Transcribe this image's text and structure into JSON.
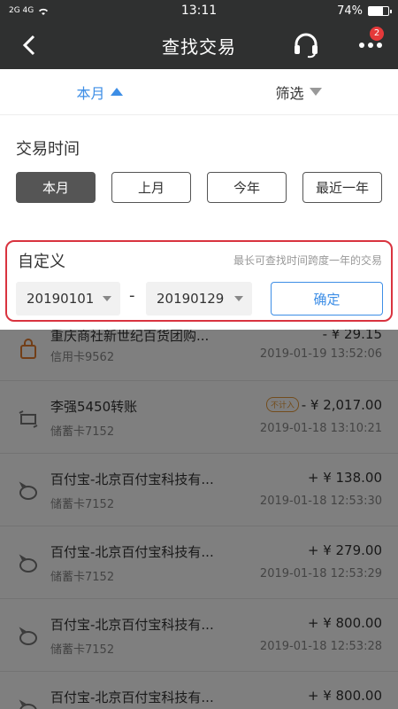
{
  "status_bar": {
    "signal": "2G 4G",
    "time": "13:11",
    "battery": "74%",
    "battery_level": 0.74
  },
  "header": {
    "title": "查找交易",
    "badge_count": "2"
  },
  "tabs": [
    {
      "label": "本月"
    },
    {
      "label": "筛选"
    }
  ],
  "filter": {
    "section_title": "交易时间",
    "periods": [
      "本月",
      "上月",
      "今年",
      "最近一年"
    ],
    "selected_period": "本月",
    "custom": {
      "title": "自定义",
      "hint": "最长可查找时间跨度一年的交易",
      "start_date": "20190101",
      "separator": "-",
      "end_date": "20190129",
      "confirm_label": "确定"
    }
  },
  "transactions": [
    {
      "name": "重庆商社新世纪百货团购...",
      "card": "信用卡9562",
      "amount": "- ¥ 29.15",
      "time": "2019-01-19 13:52:06",
      "icon": "bag-icon"
    },
    {
      "name": "李强5450转账",
      "card": "储蓄卡7152",
      "tag": "不计入",
      "amount": "- ¥ 2,017.00",
      "time": "2019-01-18 13:10:21",
      "icon": "transfer-icon"
    },
    {
      "name": "百付宝-北京百付宝科技有...",
      "card": "储蓄卡7152",
      "amount": "+ ¥ 138.00",
      "time": "2019-01-18 12:53:30",
      "icon": "piggy-bank-icon"
    },
    {
      "name": "百付宝-北京百付宝科技有...",
      "card": "储蓄卡7152",
      "amount": "+ ¥ 279.00",
      "time": "2019-01-18 12:53:29",
      "icon": "piggy-bank-icon"
    },
    {
      "name": "百付宝-北京百付宝科技有...",
      "card": "储蓄卡7152",
      "amount": "+ ¥ 800.00",
      "time": "2019-01-18 12:53:28",
      "icon": "piggy-bank-icon"
    },
    {
      "name": "百付宝-北京百付宝科技有...",
      "card": "",
      "amount": "+ ¥ 800.00",
      "time": "",
      "icon": "piggy-bank-icon"
    }
  ],
  "colors": {
    "accent": "#3d8ee6",
    "highlight_border": "#d9333f",
    "header_bg": "#2f3030"
  }
}
